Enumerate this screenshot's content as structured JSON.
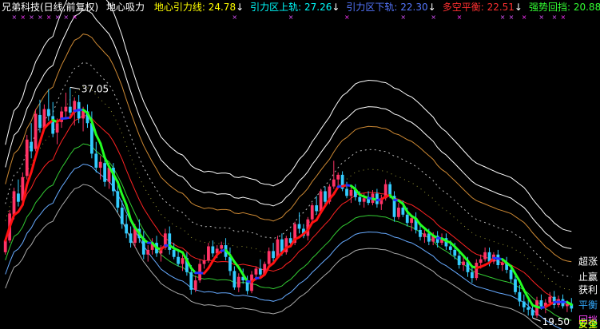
{
  "header": {
    "title": "兄弟科技(日线,前复权)",
    "indicator": "地心吸力",
    "items": [
      {
        "label": "地心引力线",
        "value": "24.78",
        "arrow": "↓",
        "color": "#ffff00"
      },
      {
        "label": "引力区上轨",
        "value": "27.26",
        "arrow": "↓",
        "color": "#00ffff"
      },
      {
        "label": "引力区下轨",
        "value": "22.30",
        "arrow": "↓",
        "color": "#5577ff"
      },
      {
        "label": "多空平衡",
        "value": "22.51",
        "arrow": "↓",
        "color": "#ff3030"
      },
      {
        "label": "强势回挡",
        "value": "20.88",
        "arrow": "↓",
        "color": "#33ff33"
      }
    ],
    "colors": {
      "title": "#ffffff",
      "indicator": "#ffffff"
    }
  },
  "annotations": {
    "high_label": "37.05",
    "low_label": "19.50"
  },
  "band_labels": [
    {
      "text": "超涨",
      "color": "#ffffff"
    },
    {
      "text": "止赢",
      "color": "#ffffff"
    },
    {
      "text": "获利",
      "color": "#ffffff"
    },
    {
      "text": "平衡",
      "color": "#33aaff"
    },
    {
      "text": "回挡",
      "color": "#ff44ff"
    },
    {
      "text": "反弹",
      "color": "#33ff33"
    },
    {
      "text": "安全",
      "color": "#ffff00"
    }
  ],
  "chart_data": {
    "type": "candlestick",
    "ylim": [
      17,
      43
    ],
    "candle_colors": {
      "up": "#ff3366",
      "down": "#33ccff"
    },
    "candles": [
      [
        23.0,
        24.2,
        22.8,
        24.0
      ],
      [
        24.0,
        26.6,
        23.8,
        26.3
      ],
      [
        26.2,
        28.5,
        25.8,
        28.2
      ],
      [
        28.0,
        29.2,
        26.9,
        27.3
      ],
      [
        27.4,
        29.8,
        27.0,
        29.4
      ],
      [
        29.5,
        33.0,
        29.2,
        32.6
      ],
      [
        32.4,
        34.0,
        31.0,
        31.6
      ],
      [
        31.8,
        35.2,
        31.6,
        34.8
      ],
      [
        34.7,
        36.0,
        33.2,
        33.6
      ],
      [
        33.6,
        35.6,
        33.4,
        35.2
      ],
      [
        35.2,
        36.9,
        34.2,
        34.6
      ],
      [
        34.6,
        35.8,
        32.8,
        33.1
      ],
      [
        33.2,
        34.4,
        32.2,
        34.0
      ],
      [
        34.1,
        35.4,
        33.6,
        35.0
      ],
      [
        35.0,
        36.6,
        34.4,
        35.4
      ],
      [
        35.4,
        37.05,
        34.6,
        34.9
      ],
      [
        34.9,
        36.2,
        33.8,
        35.9
      ],
      [
        35.8,
        36.4,
        34.0,
        34.4
      ],
      [
        34.4,
        35.4,
        33.3,
        35.1
      ],
      [
        35.0,
        35.6,
        33.6,
        34.0
      ],
      [
        34.0,
        35.0,
        31.0,
        31.4
      ],
      [
        31.4,
        32.4,
        29.8,
        30.2
      ],
      [
        30.2,
        31.2,
        29.2,
        30.7
      ],
      [
        30.6,
        31.0,
        28.6,
        29.0
      ],
      [
        29.0,
        30.6,
        28.4,
        30.2
      ],
      [
        30.2,
        30.6,
        27.8,
        28.2
      ],
      [
        28.2,
        28.8,
        26.4,
        26.8
      ],
      [
        26.8,
        27.4,
        25.0,
        25.4
      ],
      [
        25.4,
        26.2,
        24.2,
        24.6
      ],
      [
        24.6,
        25.2,
        23.4,
        23.8
      ],
      [
        23.8,
        25.4,
        23.4,
        25.0
      ],
      [
        25.0,
        25.8,
        23.8,
        24.2
      ],
      [
        24.2,
        24.8,
        22.4,
        22.8
      ],
      [
        22.8,
        23.6,
        22.2,
        23.2
      ],
      [
        23.2,
        24.2,
        22.8,
        23.8
      ],
      [
        23.8,
        24.4,
        22.6,
        22.9
      ],
      [
        22.9,
        23.6,
        22.2,
        23.4
      ],
      [
        23.4,
        25.0,
        23.2,
        24.6
      ],
      [
        24.6,
        25.2,
        22.8,
        23.2
      ],
      [
        23.2,
        23.8,
        22.4,
        22.6
      ],
      [
        22.6,
        23.2,
        21.8,
        22.0
      ],
      [
        22.0,
        22.8,
        21.4,
        22.5
      ],
      [
        22.5,
        23.0,
        21.0,
        21.3
      ],
      [
        21.3,
        21.9,
        19.4,
        19.8
      ],
      [
        19.8,
        21.0,
        19.6,
        20.6
      ],
      [
        20.6,
        22.4,
        20.4,
        22.0
      ],
      [
        22.0,
        22.8,
        21.6,
        22.3
      ],
      [
        22.3,
        23.8,
        22.1,
        23.5
      ],
      [
        23.5,
        24.0,
        22.6,
        22.9
      ],
      [
        22.9,
        23.6,
        22.5,
        23.3
      ],
      [
        23.3,
        23.9,
        22.9,
        23.6
      ],
      [
        23.6,
        24.2,
        22.3,
        22.6
      ],
      [
        22.6,
        23.4,
        21.0,
        21.4
      ],
      [
        21.4,
        21.8,
        19.8,
        20.0
      ],
      [
        20.0,
        21.2,
        19.6,
        20.9
      ],
      [
        20.9,
        21.6,
        20.3,
        20.6
      ],
      [
        20.6,
        21.0,
        19.4,
        19.7
      ],
      [
        19.7,
        21.4,
        19.5,
        21.1
      ],
      [
        21.1,
        21.8,
        20.6,
        21.6
      ],
      [
        21.6,
        22.4,
        20.8,
        21.1
      ],
      [
        21.1,
        22.2,
        21.0,
        22.0
      ],
      [
        22.0,
        23.4,
        21.8,
        23.1
      ],
      [
        23.1,
        23.8,
        22.2,
        22.5
      ],
      [
        22.5,
        24.4,
        22.4,
        24.1
      ],
      [
        24.1,
        24.6,
        22.7,
        23.0
      ],
      [
        23.0,
        24.4,
        22.8,
        24.2
      ],
      [
        24.2,
        24.7,
        23.4,
        23.8
      ],
      [
        23.8,
        25.6,
        23.6,
        25.4
      ],
      [
        25.4,
        26.4,
        24.6,
        25.0
      ],
      [
        25.0,
        25.4,
        24.2,
        24.4
      ],
      [
        24.4,
        26.0,
        24.0,
        25.8
      ],
      [
        25.8,
        27.2,
        25.6,
        27.0
      ],
      [
        27.0,
        27.8,
        26.2,
        26.5
      ],
      [
        26.5,
        28.4,
        26.3,
        28.2
      ],
      [
        28.2,
        28.6,
        27.0,
        27.3
      ],
      [
        27.3,
        28.8,
        27.1,
        28.6
      ],
      [
        28.6,
        30.8,
        28.4,
        29.2
      ],
      [
        29.2,
        29.8,
        28.4,
        29.6
      ],
      [
        29.6,
        29.9,
        28.2,
        28.4
      ],
      [
        28.4,
        29.0,
        27.6,
        27.8
      ],
      [
        27.8,
        28.6,
        27.2,
        28.3
      ],
      [
        28.3,
        28.8,
        27.4,
        27.7
      ],
      [
        27.7,
        28.2,
        27.0,
        27.3
      ],
      [
        27.3,
        28.0,
        26.8,
        27.6
      ],
      [
        27.6,
        28.2,
        27.0,
        27.2
      ],
      [
        27.2,
        28.3,
        27.0,
        28.0
      ],
      [
        28.0,
        28.4,
        26.8,
        27.1
      ],
      [
        27.1,
        27.9,
        26.6,
        27.6
      ],
      [
        27.6,
        29.2,
        27.4,
        28.8
      ],
      [
        28.8,
        29.0,
        27.6,
        27.8
      ],
      [
        27.8,
        28.2,
        25.6,
        26.0
      ],
      [
        26.0,
        27.2,
        25.8,
        26.8
      ],
      [
        26.8,
        27.4,
        26.0,
        26.2
      ],
      [
        26.2,
        26.8,
        25.2,
        25.5
      ],
      [
        25.5,
        26.2,
        24.8,
        25.9
      ],
      [
        25.9,
        26.4,
        24.6,
        24.9
      ],
      [
        24.9,
        25.4,
        24.0,
        24.3
      ],
      [
        24.3,
        24.9,
        23.8,
        24.6
      ],
      [
        24.6,
        25.0,
        23.6,
        23.9
      ],
      [
        23.9,
        24.7,
        23.6,
        24.4
      ],
      [
        24.4,
        24.8,
        23.4,
        23.8
      ],
      [
        23.8,
        24.6,
        23.6,
        24.2
      ],
      [
        24.2,
        24.6,
        23.2,
        23.5
      ],
      [
        23.5,
        24.0,
        22.8,
        23.2
      ],
      [
        23.2,
        23.8,
        22.4,
        22.7
      ],
      [
        22.7,
        23.2,
        21.6,
        21.9
      ],
      [
        21.9,
        22.6,
        21.4,
        22.2
      ],
      [
        22.2,
        22.6,
        20.9,
        21.3
      ],
      [
        21.3,
        21.8,
        20.4,
        20.8
      ],
      [
        20.8,
        22.4,
        20.6,
        22.1
      ],
      [
        22.1,
        22.8,
        21.6,
        22.4
      ],
      [
        22.4,
        23.4,
        22.2,
        23.0
      ],
      [
        23.0,
        23.4,
        21.8,
        22.2
      ],
      [
        22.2,
        23.0,
        22.0,
        22.8
      ],
      [
        22.8,
        23.2,
        21.6,
        21.9
      ],
      [
        21.9,
        22.4,
        21.4,
        22.1
      ],
      [
        22.1,
        22.6,
        21.2,
        21.5
      ],
      [
        21.5,
        21.9,
        20.4,
        20.7
      ],
      [
        20.7,
        21.2,
        19.4,
        19.6
      ],
      [
        19.6,
        20.2,
        18.4,
        18.8
      ],
      [
        18.8,
        19.4,
        17.9,
        18.3
      ],
      [
        18.3,
        19.0,
        17.6,
        18.1
      ],
      [
        18.1,
        18.6,
        17.4,
        17.6
      ],
      [
        17.6,
        19.2,
        17.4,
        18.9
      ],
      [
        18.9,
        19.4,
        18.1,
        18.4
      ],
      [
        18.4,
        19.0,
        17.8,
        18.7
      ],
      [
        18.7,
        19.6,
        18.4,
        19.2
      ],
      [
        19.2,
        19.7,
        18.2,
        18.5
      ],
      [
        18.5,
        19.3,
        18.3,
        19.0
      ],
      [
        19.0,
        19.4,
        18.2,
        18.4
      ],
      [
        18.4,
        18.9,
        17.9,
        18.6
      ],
      [
        18.6,
        19.1,
        17.9,
        18.2
      ]
    ]
  }
}
